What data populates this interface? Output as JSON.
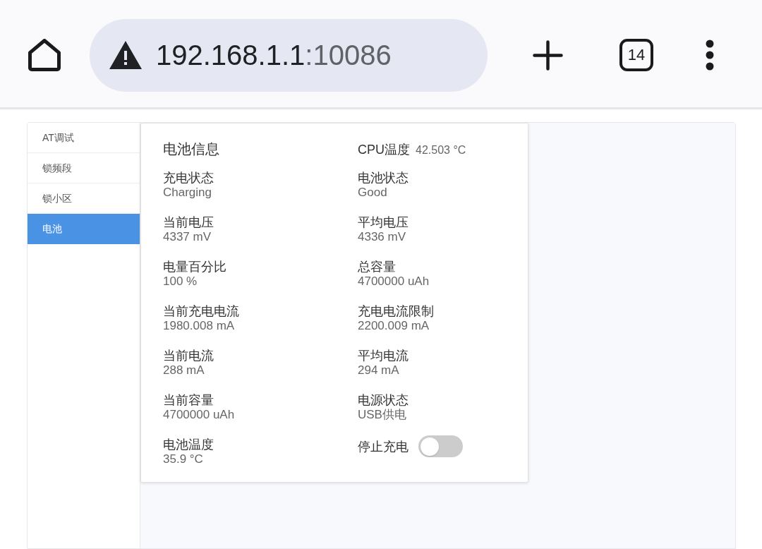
{
  "browser_bar": {
    "address": {
      "host": "192.168.1.1",
      "port": ":10086"
    },
    "tab_count": "14"
  },
  "sidebar": {
    "items": [
      {
        "label": "AT调试",
        "selected": false
      },
      {
        "label": "锁频段",
        "selected": false
      },
      {
        "label": "锁小区",
        "selected": false
      },
      {
        "label": "电池",
        "selected": true
      }
    ]
  },
  "battery_panel": {
    "title": "电池信息",
    "cpu_temperature": {
      "label": "CPU温度",
      "value": "42.503 °C"
    },
    "items": [
      {
        "kind": "reading",
        "label": "充电状态",
        "value": "Charging"
      },
      {
        "kind": "reading",
        "label": "电池状态",
        "value": "Good"
      },
      {
        "kind": "reading",
        "label": "当前电压",
        "value": "4337 mV"
      },
      {
        "kind": "reading",
        "label": "平均电压",
        "value": "4336 mV"
      },
      {
        "kind": "reading",
        "label": "电量百分比",
        "value": "100 %"
      },
      {
        "kind": "reading",
        "label": "总容量",
        "value": "4700000 uAh"
      },
      {
        "kind": "reading",
        "label": "当前充电电流",
        "value": "1980.008 mA"
      },
      {
        "kind": "reading",
        "label": "充电电流限制",
        "value": "2200.009 mA"
      },
      {
        "kind": "reading",
        "label": "当前电流",
        "value": "288 mA"
      },
      {
        "kind": "reading",
        "label": "平均电流",
        "value": "294 mA"
      },
      {
        "kind": "reading",
        "label": "当前容量",
        "value": "4700000 uAh"
      },
      {
        "kind": "reading",
        "label": "电源状态",
        "value": "USB供电"
      },
      {
        "kind": "reading",
        "label": "电池温度",
        "value": "35.9 °C"
      },
      {
        "kind": "switch",
        "label": "停止充电",
        "on": false
      }
    ]
  }
}
